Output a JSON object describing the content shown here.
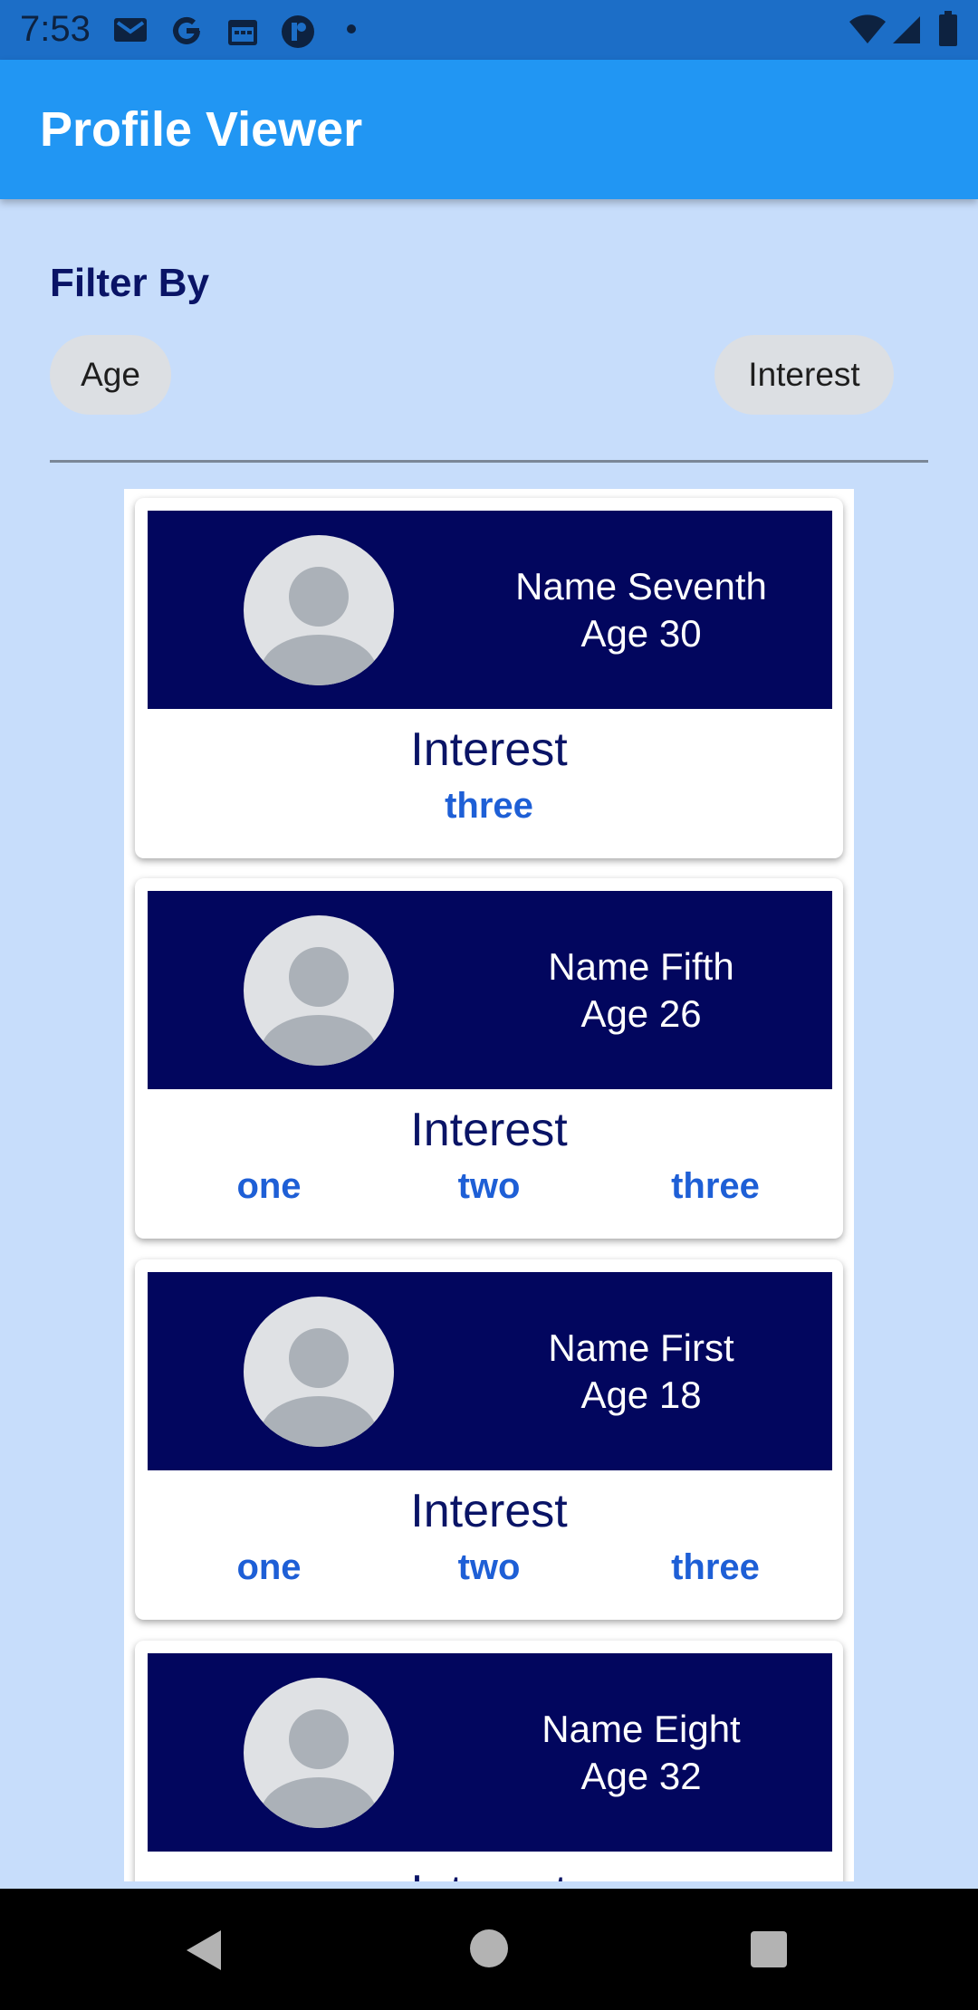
{
  "status_bar": {
    "time": "7:53",
    "left_icons": [
      "gmail-icon",
      "google-icon",
      "calendar-icon",
      "app-icon",
      "dot-icon"
    ],
    "right_icons": [
      "wifi-icon",
      "signal-icon",
      "battery-icon"
    ]
  },
  "app_bar": {
    "title": "Profile Viewer"
  },
  "filter": {
    "title": "Filter By",
    "chips": [
      {
        "label": "Age"
      },
      {
        "label": "Interest"
      }
    ]
  },
  "profiles": [
    {
      "name": "Name Seventh",
      "age": "Age 30",
      "interest_heading": "Interest",
      "interests": [
        "three"
      ]
    },
    {
      "name": "Name Fifth",
      "age": "Age 26",
      "interest_heading": "Interest",
      "interests": [
        "one",
        "two",
        "three"
      ]
    },
    {
      "name": "Name First",
      "age": "Age 18",
      "interest_heading": "Interest",
      "interests": [
        "one",
        "two",
        "three"
      ]
    },
    {
      "name": "Name Eight",
      "age": "Age 32",
      "interest_heading": "Interest",
      "interests": []
    }
  ],
  "nav_bar": {
    "buttons": [
      "back-icon",
      "home-icon",
      "recents-icon"
    ]
  },
  "colors": {
    "app_bar": "#2196f3",
    "status_bar": "#1c6ec7",
    "background": "#c7ddfb",
    "card_header": "#02065e",
    "interest_tag": "#1e5fd6",
    "heading_text": "#0a1466"
  }
}
